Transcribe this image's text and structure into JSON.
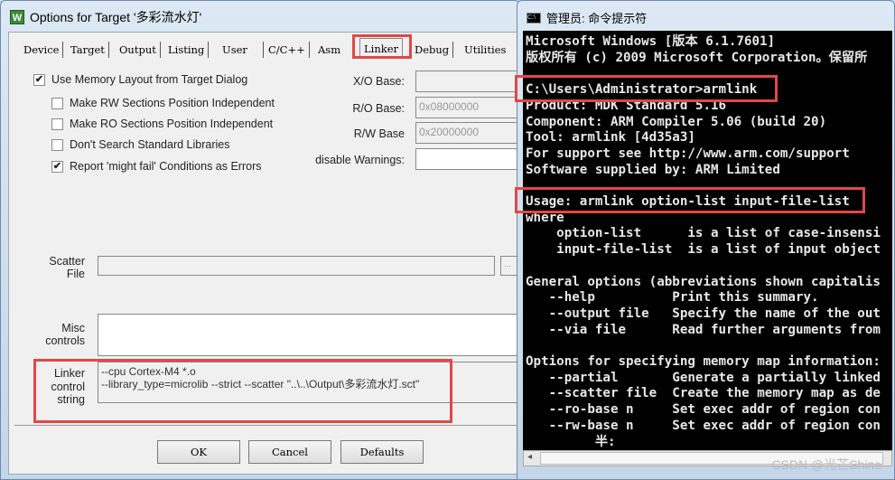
{
  "dialog": {
    "title": "Options for Target '多彩流水灯'",
    "app_icon": "W",
    "tabs": [
      "Device",
      "Target",
      "Output",
      "Listing",
      "User",
      "C/C++",
      "Asm",
      "Linker",
      "Debug",
      "Utilities"
    ],
    "active_tab": "Linker",
    "checkboxes": [
      {
        "label": "Use Memory Layout from Target Dialog",
        "checked": true
      },
      {
        "label": "Make RW Sections Position Independent",
        "checked": false
      },
      {
        "label": "Make RO Sections Position Independent",
        "checked": false
      },
      {
        "label": "Don't Search Standard Libraries",
        "checked": false
      },
      {
        "label": "Report 'might fail' Conditions as Errors",
        "checked": true
      }
    ],
    "xo_base_label": "X/O Base:",
    "xo_base_value": "",
    "ro_base_label": "R/O Base:",
    "ro_base_value": "0x08000000",
    "rw_base_label": "R/W Base",
    "rw_base_value": "0x20000000",
    "disable_warnings_label": "disable Warnings:",
    "disable_warnings_value": "",
    "scatter_label_1": "Scatter",
    "scatter_label_2": "File",
    "scatter_value": "",
    "browse_label": "...",
    "misc_label_1": "Misc",
    "misc_label_2": "controls",
    "misc_value": "",
    "linker_label_1": "Linker",
    "linker_label_2": "control",
    "linker_label_3": "string",
    "linker_string_1": "--cpu Cortex-M4 *.o",
    "linker_string_2": "--library_type=microlib --strict --scatter \"..\\..\\Output\\多彩流水灯.sct\"",
    "ok": "OK",
    "cancel": "Cancel",
    "defaults": "Defaults"
  },
  "cmd": {
    "title": "管理员: 命令提示符",
    "lines": [
      "Microsoft Windows [版本 6.1.7601]",
      "版权所有 (c) 2009 Microsoft Corporation。保留所",
      "",
      "C:\\Users\\Administrator>armlink",
      "Product: MDK Standard 5.16",
      "Component: ARM Compiler 5.06 (build 20)",
      "Tool: armlink [4d35a3]",
      "For support see http://www.arm.com/support",
      "Software supplied by: ARM Limited",
      "",
      "Usage: armlink option-list input-file-list",
      "where",
      "    option-list      is a list of case-insensi",
      "    input-file-list  is a list of input object",
      "",
      "General options (abbreviations shown capitalis",
      "   --help          Print this summary.",
      "   --output file   Specify the name of the out",
      "   --via file      Read further arguments from",
      "",
      "Options for specifying memory map information:",
      "   --partial       Generate a partially linked",
      "   --scatter file  Create the memory map as de",
      "   --ro-base n     Set exec addr of region con",
      "   --rw-base n     Set exec addr of region con",
      "         半:"
    ],
    "watermark": "CSDN @光芒Shine"
  },
  "colors": {
    "highlight": "#e04848",
    "console_bg": "#000000"
  }
}
